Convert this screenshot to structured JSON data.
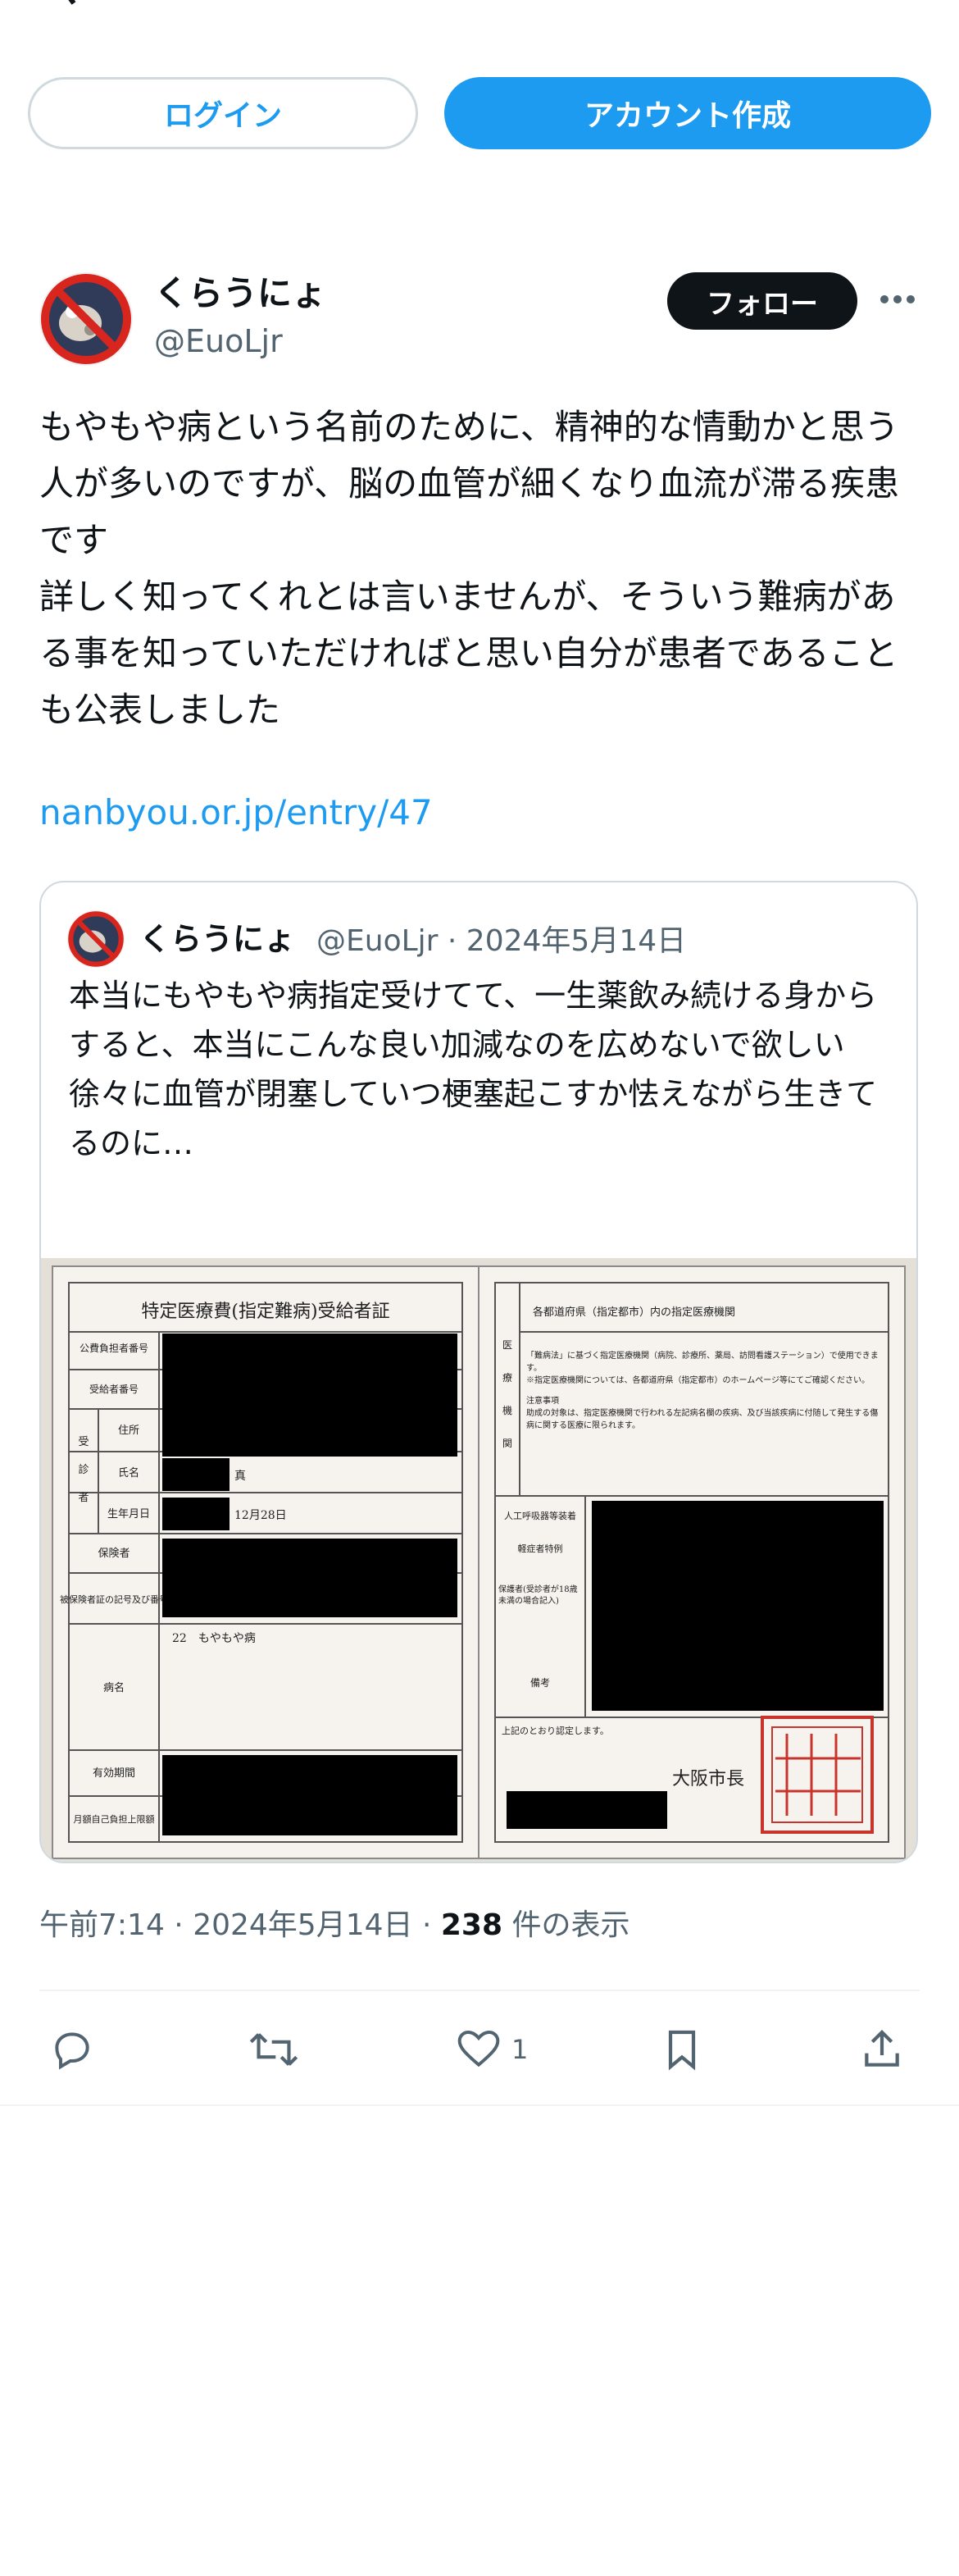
{
  "header": {
    "logo_icon": "x-logo-icon"
  },
  "auth": {
    "login_label": "ログイン",
    "signup_label": "アカウント作成"
  },
  "author": {
    "name": "くらうにょ",
    "handle": "@EuoLjr",
    "follow_label": "フォロー"
  },
  "tweet": {
    "text": "もやもや病という名前のために、精神的な情動かと思う人が多いのですが、脳の血管が細くなり血流が滞る疾患です\n詳しく知ってくれとは言いませんが、そういう難病がある事を知っていただければと思い自分が患者であることも公表しました",
    "link": "nanbyou.or.jp/entry/47",
    "time": "午前7:14",
    "date": "2024年5月14日",
    "views_count": "238",
    "views_label": "件の表示"
  },
  "quote": {
    "name": "くらうにょ",
    "handle": "@EuoLjr",
    "date": "2024年5月14日",
    "text": "本当にもやもや病指定受けてて、一生薬飲み続ける身からすると、本当にこんな良い加減なのを広めないで欲しい\n徐々に血管が閉塞していつ梗塞起こすか怯えながら生きてるのに…",
    "image": {
      "left_title": "特定医療費(指定難病)受給者証",
      "rows": [
        "公費負担者番号",
        "受給者番号",
        "住所",
        "氏名",
        "生年月日",
        "保険者",
        "被保険者証の記号及び番号",
        "病名",
        "有効期間",
        "月額自己負担上限額"
      ],
      "left_labels": [
        "受",
        "診",
        "者"
      ],
      "name_suffix": "真",
      "birth_suffix": "12月28日",
      "disease": "22　もやもや病",
      "right_header": "各都道府県（指定都市）内の指定医療機関",
      "right_side": [
        "医",
        "療",
        "機",
        "関"
      ],
      "right_note1": "「難病法」に基づく指定医療機関（病院、診療所、薬局、訪問看護ステーション）で使用できます。",
      "right_note2": "※指定医療機関については、各都道府県（指定都市）のホームページ等にてご確認ください。",
      "right_note3": "注意事項",
      "right_note4": "助成の対象は、指定医療機関で行われる左記病名欄の疾病、及び当該疾病に付随して発生する傷病に関する医療に限られます。",
      "ventilator": "人工呼吸器等装着",
      "light_case": "軽症者特例",
      "guardian": "保護者(受診者が18歳未満の場合記入)",
      "remarks": "備考",
      "certified": "上記のとおり認定します。",
      "mayor": "大阪市長"
    }
  },
  "actions": {
    "like_count": "1"
  }
}
